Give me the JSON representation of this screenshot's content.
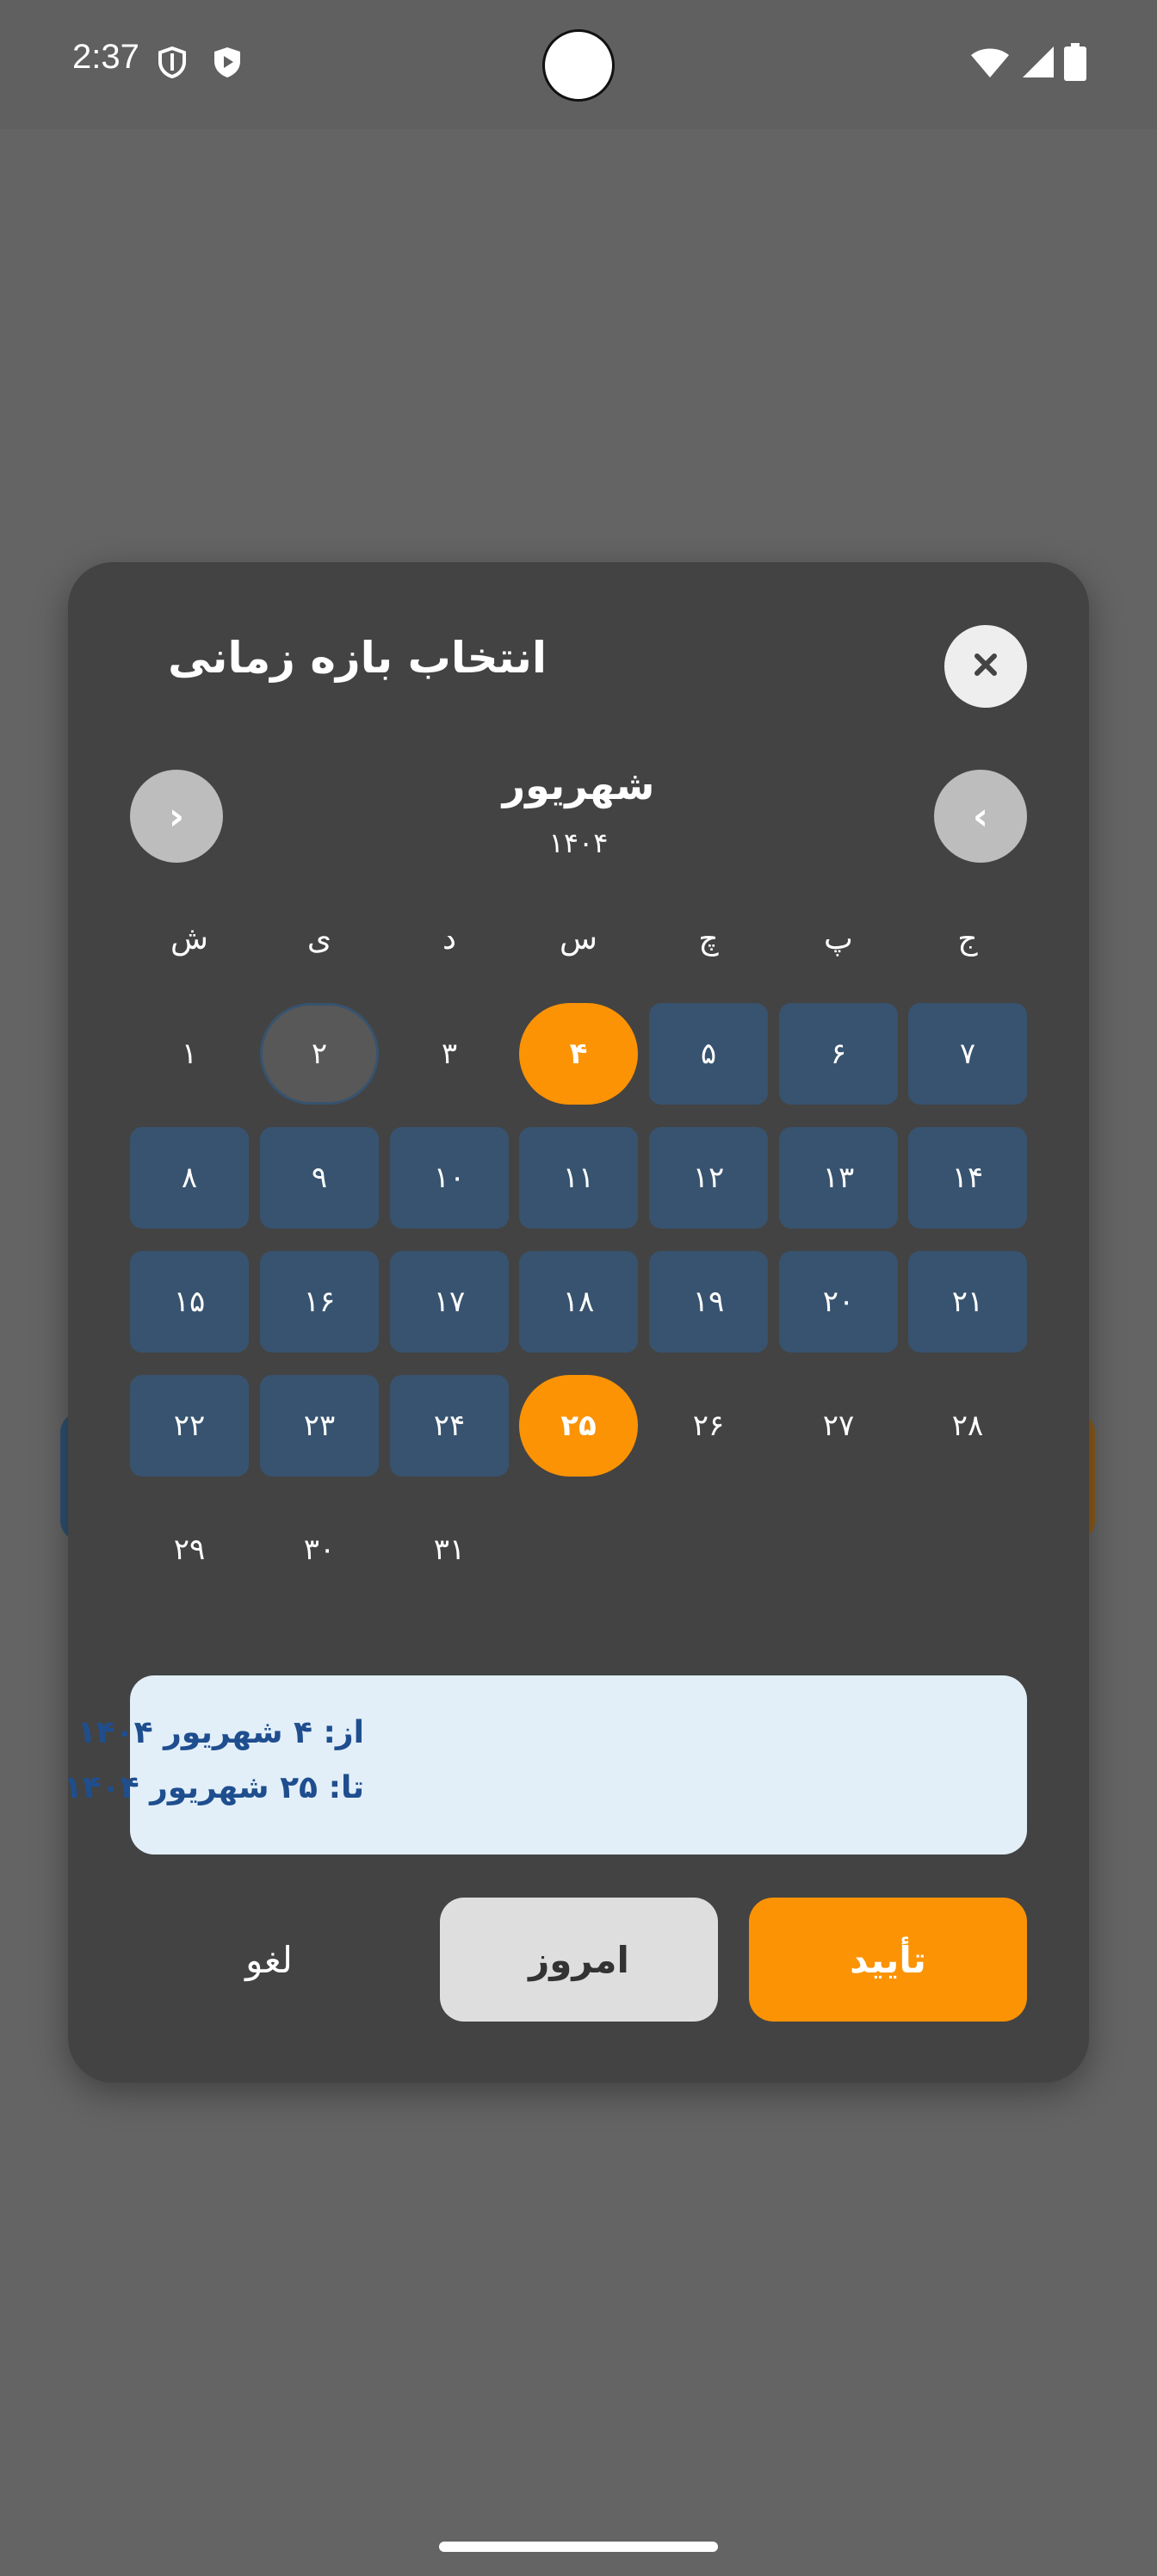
{
  "status_bar": {
    "time": "2:37",
    "left_icons": [
      "shield-icon",
      "play-protect-icon"
    ],
    "right_icons": [
      "wifi-icon",
      "signal-icon",
      "battery-icon"
    ]
  },
  "dialog": {
    "title": "انتخاب بازه زمانی",
    "close_icon": "close-icon",
    "month": "شهریور",
    "year": "۱۴۰۴",
    "prev_label": "‹",
    "next_label": "›",
    "weekdays": [
      "ش",
      "ی",
      "د",
      "س",
      "چ",
      "پ",
      "ج"
    ],
    "days": [
      "۱",
      "۲",
      "۳",
      "۴",
      "۵",
      "۶",
      "۷",
      "۸",
      "۹",
      "۱۰",
      "۱۱",
      "۱۲",
      "۱۳",
      "۱۴",
      "۱۵",
      "۱۶",
      "۱۷",
      "۱۸",
      "۱۹",
      "۲۰",
      "۲۱",
      "۲۲",
      "۲۳",
      "۲۴",
      "۲۵",
      "۲۶",
      "۲۷",
      "۲۸",
      "۲۹",
      "۳۰",
      "۳۱"
    ],
    "range_start_day": 4,
    "range_end_day": 25,
    "today_day": 2,
    "summary": {
      "from": "از: ۴ شهریور ۱۴۰۴",
      "to": "تا: ۲۵ شهریور ۱۴۰۴"
    },
    "buttons": {
      "confirm": "تأیید",
      "today": "امروز",
      "cancel": "لغو"
    }
  },
  "colors": {
    "accent": "#fb9304",
    "range": "#37536f",
    "dialog_bg": "#434343",
    "summary_bg": "#e2eff9",
    "summary_text": "#1f4e8f"
  }
}
